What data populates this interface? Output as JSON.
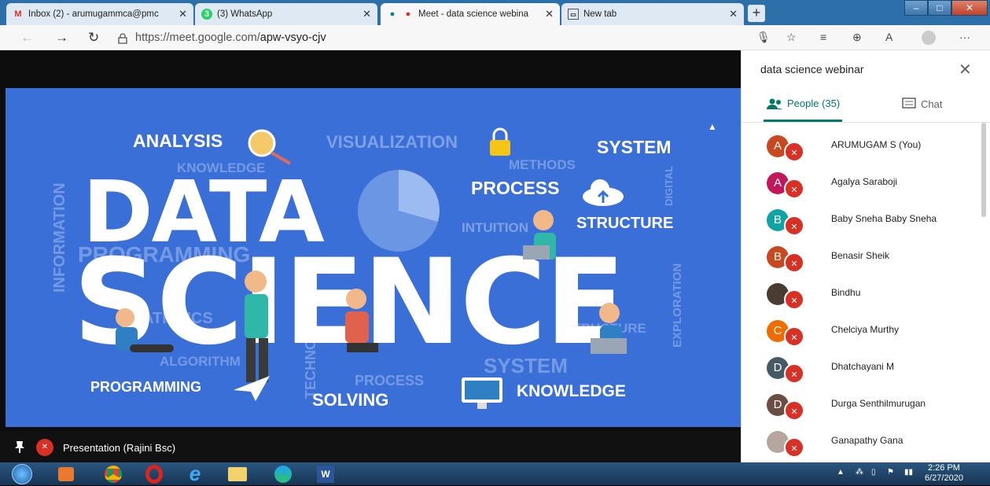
{
  "browser": {
    "tabs": [
      {
        "label": "Inbox (2) - arumugammca@pmc",
        "icon": "gmail-icon"
      },
      {
        "label": "(3) WhatsApp",
        "icon": "whatsapp-icon"
      },
      {
        "label": "Meet - data science webina",
        "icon": "meet-icon"
      },
      {
        "label": "New tab",
        "icon": "newtab-icon"
      }
    ],
    "new_tab": "+",
    "url_host": "https://meet.google.com/",
    "url_path": "apw-vsyo-cjv"
  },
  "slide": {
    "top_words": [
      "ANALYSIS",
      "VISUALIZATION",
      "SYSTEM",
      "PROCESS",
      "STRUCTURE",
      "INTUITION"
    ],
    "faded_words": [
      "KNOWLEDGE",
      "METHODS",
      "INFORMATION",
      "PROGRAMMING",
      "TECHNOLOGY",
      "ALGORITHM",
      "STATISTICS",
      "DIGITAL",
      "EXPLORATION",
      "SYSTEM",
      "PROCESS",
      "STRUCTURE"
    ],
    "big_words": [
      "DATA",
      "SCIENCE"
    ],
    "bottom_words": [
      "PROGRAMMING",
      "SOLVING",
      "KNOWLEDGE"
    ]
  },
  "presentation_bar": {
    "label": "Presentation (Rajini Bsc)"
  },
  "side_panel": {
    "title": "data science webinar",
    "close": "✕",
    "people_tab": "People (35)",
    "chat_tab": "Chat",
    "participants": [
      {
        "name": "ARUMUGAM S (You)",
        "initial": "A",
        "color": "#c8481f"
      },
      {
        "name": "Agalya Saraboji",
        "initial": "A",
        "color": "#c2185b"
      },
      {
        "name": "Baby Sneha Baby Sneha",
        "initial": "B",
        "color": "#12a4a4"
      },
      {
        "name": "Benasir Sheik",
        "initial": "B",
        "color": "#c8481f"
      },
      {
        "name": "Bindhu",
        "initial": "",
        "color": "#4a3b33"
      },
      {
        "name": "Chelciya Murthy",
        "initial": "C",
        "color": "#ef6c00"
      },
      {
        "name": "Dhatchayani M",
        "initial": "D",
        "color": "#455a64"
      },
      {
        "name": "Durga Senthilmurugan",
        "initial": "D",
        "color": "#6d4c41"
      },
      {
        "name": "Ganapathy Gana",
        "initial": "",
        "color": "#b5a7a0"
      }
    ]
  },
  "taskbar": {
    "time": "2:26 PM",
    "date": "6/27/2020"
  }
}
